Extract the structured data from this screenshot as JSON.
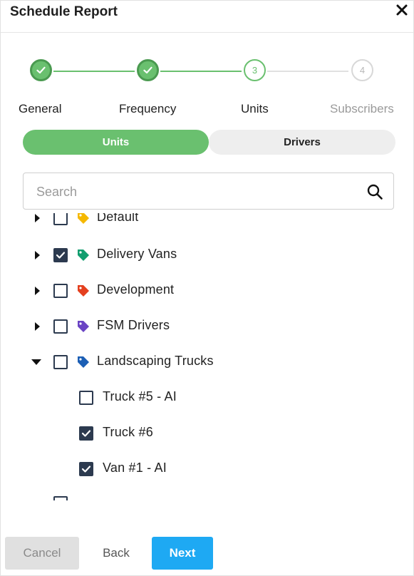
{
  "dialog": {
    "title": "Schedule Report"
  },
  "stepper": {
    "steps": [
      {
        "label": "General",
        "state": "done"
      },
      {
        "label": "Frequency",
        "state": "done"
      },
      {
        "number": "3",
        "label": "Units",
        "state": "active"
      },
      {
        "number": "4",
        "label": "Subscribers",
        "state": "todo"
      }
    ]
  },
  "tabs": {
    "units_label": "Units",
    "drivers_label": "Drivers",
    "selected": "Units"
  },
  "search": {
    "placeholder": "Search",
    "value": ""
  },
  "tree": {
    "items": [
      {
        "label": "Default",
        "checked": false,
        "tag_color": "#f5b800"
      },
      {
        "label": "Delivery Vans",
        "checked": true,
        "tag_color": "#129e6f"
      },
      {
        "label": "Development",
        "checked": false,
        "tag_color": "#e4401f"
      },
      {
        "label": "FSM Drivers",
        "checked": false,
        "tag_color": "#6a44c4"
      },
      {
        "label": "Landscaping Trucks",
        "checked": false,
        "expanded": true,
        "tag_color": "#1c5fb5",
        "children": [
          {
            "label": "Truck #5 - AI",
            "checked": false
          },
          {
            "label": "Truck #6",
            "checked": true
          },
          {
            "label": "Van #1 - AI",
            "checked": true
          }
        ]
      }
    ]
  },
  "footer": {
    "cancel_label": "Cancel",
    "back_label": "Back",
    "next_label": "Next"
  },
  "colors": {
    "accent_green": "#6ac06f",
    "primary_blue": "#1ea9f3",
    "checkbox_navy": "#2c3a4f"
  }
}
